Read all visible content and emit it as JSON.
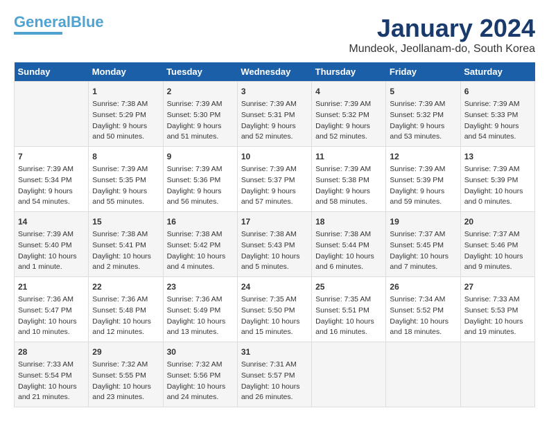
{
  "header": {
    "logo_line1": "General",
    "logo_line2": "Blue",
    "month_title": "January 2024",
    "location": "Mundeok, Jeollanam-do, South Korea"
  },
  "days_of_week": [
    "Sunday",
    "Monday",
    "Tuesday",
    "Wednesday",
    "Thursday",
    "Friday",
    "Saturday"
  ],
  "weeks": [
    [
      {
        "day": "",
        "info": ""
      },
      {
        "day": "1",
        "info": "Sunrise: 7:38 AM\nSunset: 5:29 PM\nDaylight: 9 hours\nand 50 minutes."
      },
      {
        "day": "2",
        "info": "Sunrise: 7:39 AM\nSunset: 5:30 PM\nDaylight: 9 hours\nand 51 minutes."
      },
      {
        "day": "3",
        "info": "Sunrise: 7:39 AM\nSunset: 5:31 PM\nDaylight: 9 hours\nand 52 minutes."
      },
      {
        "day": "4",
        "info": "Sunrise: 7:39 AM\nSunset: 5:32 PM\nDaylight: 9 hours\nand 52 minutes."
      },
      {
        "day": "5",
        "info": "Sunrise: 7:39 AM\nSunset: 5:32 PM\nDaylight: 9 hours\nand 53 minutes."
      },
      {
        "day": "6",
        "info": "Sunrise: 7:39 AM\nSunset: 5:33 PM\nDaylight: 9 hours\nand 54 minutes."
      }
    ],
    [
      {
        "day": "7",
        "info": "Sunrise: 7:39 AM\nSunset: 5:34 PM\nDaylight: 9 hours\nand 54 minutes."
      },
      {
        "day": "8",
        "info": "Sunrise: 7:39 AM\nSunset: 5:35 PM\nDaylight: 9 hours\nand 55 minutes."
      },
      {
        "day": "9",
        "info": "Sunrise: 7:39 AM\nSunset: 5:36 PM\nDaylight: 9 hours\nand 56 minutes."
      },
      {
        "day": "10",
        "info": "Sunrise: 7:39 AM\nSunset: 5:37 PM\nDaylight: 9 hours\nand 57 minutes."
      },
      {
        "day": "11",
        "info": "Sunrise: 7:39 AM\nSunset: 5:38 PM\nDaylight: 9 hours\nand 58 minutes."
      },
      {
        "day": "12",
        "info": "Sunrise: 7:39 AM\nSunset: 5:39 PM\nDaylight: 9 hours\nand 59 minutes."
      },
      {
        "day": "13",
        "info": "Sunrise: 7:39 AM\nSunset: 5:39 PM\nDaylight: 10 hours\nand 0 minutes."
      }
    ],
    [
      {
        "day": "14",
        "info": "Sunrise: 7:39 AM\nSunset: 5:40 PM\nDaylight: 10 hours\nand 1 minute."
      },
      {
        "day": "15",
        "info": "Sunrise: 7:38 AM\nSunset: 5:41 PM\nDaylight: 10 hours\nand 2 minutes."
      },
      {
        "day": "16",
        "info": "Sunrise: 7:38 AM\nSunset: 5:42 PM\nDaylight: 10 hours\nand 4 minutes."
      },
      {
        "day": "17",
        "info": "Sunrise: 7:38 AM\nSunset: 5:43 PM\nDaylight: 10 hours\nand 5 minutes."
      },
      {
        "day": "18",
        "info": "Sunrise: 7:38 AM\nSunset: 5:44 PM\nDaylight: 10 hours\nand 6 minutes."
      },
      {
        "day": "19",
        "info": "Sunrise: 7:37 AM\nSunset: 5:45 PM\nDaylight: 10 hours\nand 7 minutes."
      },
      {
        "day": "20",
        "info": "Sunrise: 7:37 AM\nSunset: 5:46 PM\nDaylight: 10 hours\nand 9 minutes."
      }
    ],
    [
      {
        "day": "21",
        "info": "Sunrise: 7:36 AM\nSunset: 5:47 PM\nDaylight: 10 hours\nand 10 minutes."
      },
      {
        "day": "22",
        "info": "Sunrise: 7:36 AM\nSunset: 5:48 PM\nDaylight: 10 hours\nand 12 minutes."
      },
      {
        "day": "23",
        "info": "Sunrise: 7:36 AM\nSunset: 5:49 PM\nDaylight: 10 hours\nand 13 minutes."
      },
      {
        "day": "24",
        "info": "Sunrise: 7:35 AM\nSunset: 5:50 PM\nDaylight: 10 hours\nand 15 minutes."
      },
      {
        "day": "25",
        "info": "Sunrise: 7:35 AM\nSunset: 5:51 PM\nDaylight: 10 hours\nand 16 minutes."
      },
      {
        "day": "26",
        "info": "Sunrise: 7:34 AM\nSunset: 5:52 PM\nDaylight: 10 hours\nand 18 minutes."
      },
      {
        "day": "27",
        "info": "Sunrise: 7:33 AM\nSunset: 5:53 PM\nDaylight: 10 hours\nand 19 minutes."
      }
    ],
    [
      {
        "day": "28",
        "info": "Sunrise: 7:33 AM\nSunset: 5:54 PM\nDaylight: 10 hours\nand 21 minutes."
      },
      {
        "day": "29",
        "info": "Sunrise: 7:32 AM\nSunset: 5:55 PM\nDaylight: 10 hours\nand 23 minutes."
      },
      {
        "day": "30",
        "info": "Sunrise: 7:32 AM\nSunset: 5:56 PM\nDaylight: 10 hours\nand 24 minutes."
      },
      {
        "day": "31",
        "info": "Sunrise: 7:31 AM\nSunset: 5:57 PM\nDaylight: 10 hours\nand 26 minutes."
      },
      {
        "day": "",
        "info": ""
      },
      {
        "day": "",
        "info": ""
      },
      {
        "day": "",
        "info": ""
      }
    ]
  ]
}
